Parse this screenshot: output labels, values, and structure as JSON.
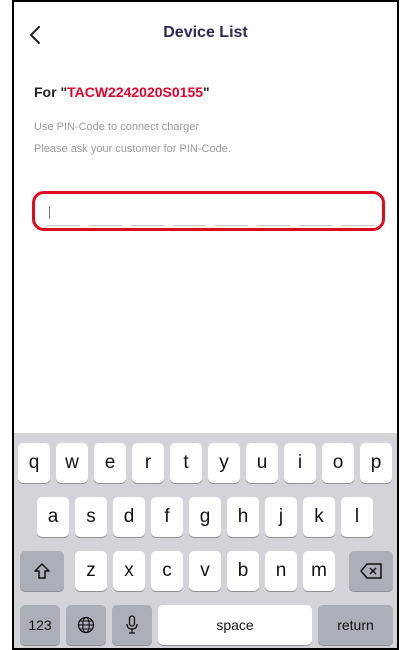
{
  "header": {
    "title": "Device List",
    "back_icon": "chevron-left-icon"
  },
  "content": {
    "for_prefix": "For \"",
    "serial": "TACW2242020S0155",
    "for_suffix": "\"",
    "hint_line1": "Use PIN-Code to connect charger",
    "hint_line2": "Please ask your customer for PIN-Code.",
    "pin_slots": 8,
    "pin_value": ""
  },
  "colors": {
    "accent": "#e3002b",
    "title": "#2d2a55",
    "highlight_border": "#e00a1e",
    "keyboard_bg": "#d2d4da"
  },
  "keyboard": {
    "row1": [
      "q",
      "w",
      "e",
      "r",
      "t",
      "y",
      "u",
      "i",
      "o",
      "p"
    ],
    "row2": [
      "a",
      "s",
      "d",
      "f",
      "g",
      "h",
      "j",
      "k",
      "l"
    ],
    "row3": [
      "z",
      "x",
      "c",
      "v",
      "b",
      "n",
      "m"
    ],
    "shift_icon": "shift-icon",
    "delete_icon": "backspace-icon",
    "numbers_label": "123",
    "globe_icon": "globe-icon",
    "mic_icon": "microphone-icon",
    "space_label": "space",
    "return_label": "return"
  }
}
